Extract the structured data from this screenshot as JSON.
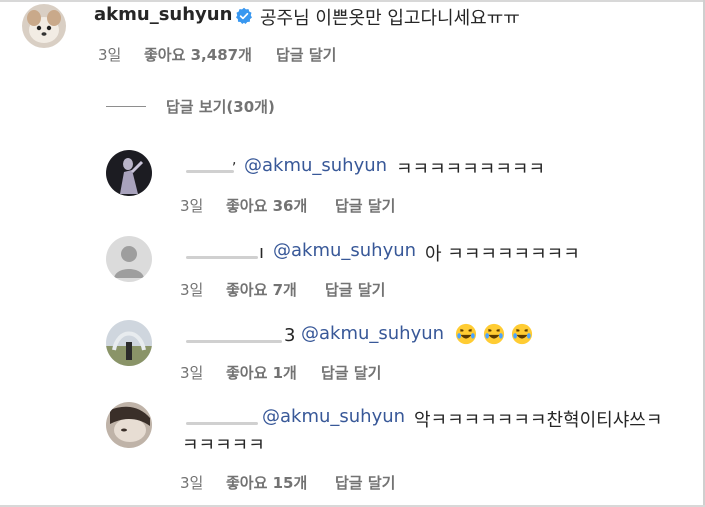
{
  "main_comment": {
    "username": "akmu_suhyun",
    "text": "공주님 이쁜옷만 입고다니세요ㅠㅠ",
    "time": "3일",
    "likes": "좋아요 3,487개",
    "reply_label": "답글 달기"
  },
  "view_replies_label": "답글 보기(30개)",
  "replies": [
    {
      "mention": "@akmu_suhyun",
      "text": "ㅋㅋㅋㅋㅋㅋㅋㅋㅋ",
      "time": "3일",
      "likes": "좋아요 36개",
      "reply_label": "답글 달기"
    },
    {
      "mention": "@akmu_suhyun",
      "text": "아 ㅋㅋㅋㅋㅋㅋㅋㅋ",
      "time": "3일",
      "likes": "좋아요 7개",
      "reply_label": "답글 달기"
    },
    {
      "mention": "@akmu_suhyun",
      "time": "3일",
      "likes": "좋아요 1개",
      "reply_label": "답글 달기",
      "emoji": [
        "rolling-on-floor-laughing",
        "rolling-on-floor-laughing",
        "rolling-on-floor-laughing"
      ]
    },
    {
      "mention": "@akmu_suhyun",
      "text": "악ㅋㅋㅋㅋㅋㅋㅋ찬혁이티샤쓰ㅋ",
      "text_line2": "ㅋㅋㅋㅋㅋ",
      "time": "3일",
      "likes": "좋아요 15개",
      "reply_label": "답글 달기"
    }
  ],
  "colors": {
    "mention": "#385898",
    "meta": "#737373",
    "verified": "#3897f0"
  },
  "icons": [
    "verified-badge-icon",
    "default-avatar-icon",
    "laughing-emoji-icon"
  ]
}
